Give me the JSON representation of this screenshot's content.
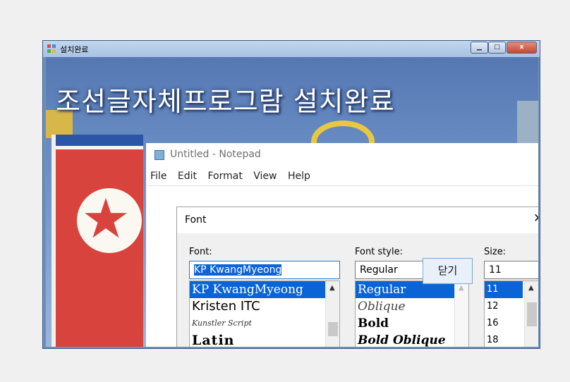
{
  "window": {
    "title": "설치완료",
    "controls": {
      "minimize": "▁",
      "maximize": "□",
      "close": "x"
    }
  },
  "banner": {
    "title": "조선글자체프로그람 설치완료"
  },
  "notepad": {
    "title": "Untitled - Notepad",
    "menu": [
      "File",
      "Edit",
      "Format",
      "View",
      "Help"
    ]
  },
  "font_dialog": {
    "title": "Font",
    "close": "✕",
    "font": {
      "label": "Font:",
      "value": "KP KwangMyeong",
      "items": [
        "KP KwangMyeong",
        "Kristen ITC",
        "Kunstler Script",
        "Latin"
      ]
    },
    "style": {
      "label": "Font style:",
      "value": "Regular",
      "items": [
        "Regular",
        "Oblique",
        "Bold",
        "Bold Oblique"
      ]
    },
    "size": {
      "label": "Size:",
      "value": "11",
      "items": [
        "11",
        "12",
        "16",
        "18"
      ]
    }
  },
  "close_button": {
    "label": "닫기"
  },
  "colors": {
    "selection": "#0a64d6",
    "flag_red": "#d8443d",
    "flag_blue": "#2b56a7"
  }
}
